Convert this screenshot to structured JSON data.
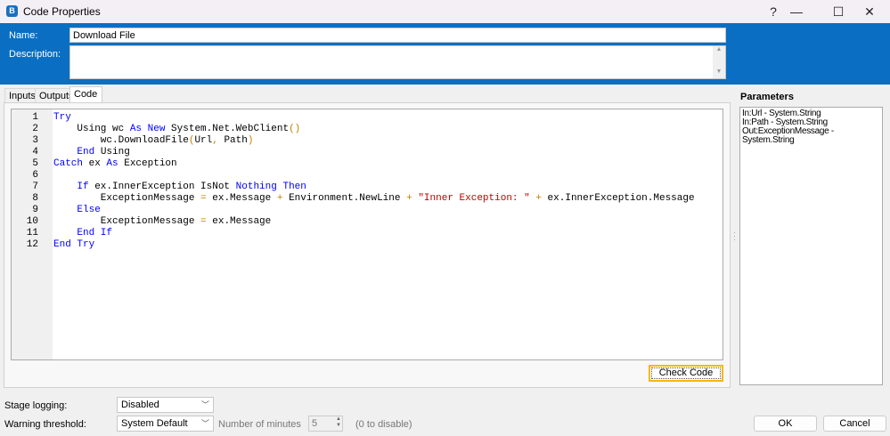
{
  "window": {
    "title": "Code Properties",
    "help": "?",
    "minimize": "—",
    "maximize": "☐",
    "close": "✕",
    "app_icon": "B"
  },
  "header": {
    "name_label": "Name:",
    "name_value": "Download File",
    "description_label": "Description:",
    "description_value": ""
  },
  "tabs": [
    {
      "label": "Inputs"
    },
    {
      "label": "Outputs"
    },
    {
      "label": "Code",
      "selected": true
    }
  ],
  "code": {
    "line_numbers": [
      "1",
      "2",
      "3",
      "4",
      "5",
      "6",
      "7",
      "8",
      "9",
      "10",
      "11",
      "12"
    ],
    "lines": [
      [
        [
          "Try",
          "k"
        ]
      ],
      [
        [
          "    Using wc ",
          "n"
        ],
        [
          "As",
          "k"
        ],
        [
          " ",
          "n"
        ],
        [
          "New",
          "k"
        ],
        [
          " System.Net.WebClient",
          "n"
        ],
        [
          "()",
          "o"
        ]
      ],
      [
        [
          "        wc.DownloadFile",
          "n"
        ],
        [
          "(",
          "o"
        ],
        [
          "Url",
          ""
        ],
        [
          ",",
          "o"
        ],
        [
          " Path",
          ""
        ],
        [
          ")",
          "o"
        ]
      ],
      [
        [
          "    ",
          "n"
        ],
        [
          "End",
          "k"
        ],
        [
          " Using",
          "n"
        ]
      ],
      [
        [
          "Catch",
          "k"
        ],
        [
          " ex ",
          "n"
        ],
        [
          "As",
          "k"
        ],
        [
          " Exception",
          "n"
        ]
      ],
      [],
      [
        [
          "    ",
          "n"
        ],
        [
          "If",
          "k"
        ],
        [
          " ex.InnerException IsNot ",
          "n"
        ],
        [
          "Nothing",
          "k"
        ],
        [
          " ",
          "n"
        ],
        [
          "Then",
          "k"
        ]
      ],
      [
        [
          "        ExceptionMessage ",
          "n"
        ],
        [
          "=",
          "o"
        ],
        [
          " ex.Message ",
          "n"
        ],
        [
          "+",
          "o"
        ],
        [
          " Environment.NewLine ",
          "n"
        ],
        [
          "+",
          "o"
        ],
        [
          " ",
          "n"
        ],
        [
          "\"Inner Exception: \"",
          "s"
        ],
        [
          " ",
          "n"
        ],
        [
          "+",
          "o"
        ],
        [
          " ex.InnerException.Message",
          "n"
        ]
      ],
      [
        [
          "    ",
          "n"
        ],
        [
          "Else",
          "k"
        ]
      ],
      [
        [
          "        ExceptionMessage ",
          "n"
        ],
        [
          "=",
          "o"
        ],
        [
          " ex.Message",
          "n"
        ]
      ],
      [
        [
          "    ",
          "n"
        ],
        [
          "End If",
          "k"
        ]
      ],
      [
        [
          "End Try",
          "k"
        ]
      ]
    ]
  },
  "check_code_label": "Check Code",
  "parameters": {
    "label": "Parameters",
    "items": [
      "In:Url - System.String",
      "In:Path - System.String",
      "Out:ExceptionMessage - System.String"
    ]
  },
  "footer": {
    "stage_logging_label": "Stage logging:",
    "stage_logging_value": "Disabled",
    "warning_label": "Warning threshold:",
    "warning_value": "System Default",
    "minutes_label": "Number of minutes",
    "minutes_value": "5",
    "minutes_hint": "(0 to disable)",
    "ok": "OK",
    "cancel": "Cancel"
  }
}
